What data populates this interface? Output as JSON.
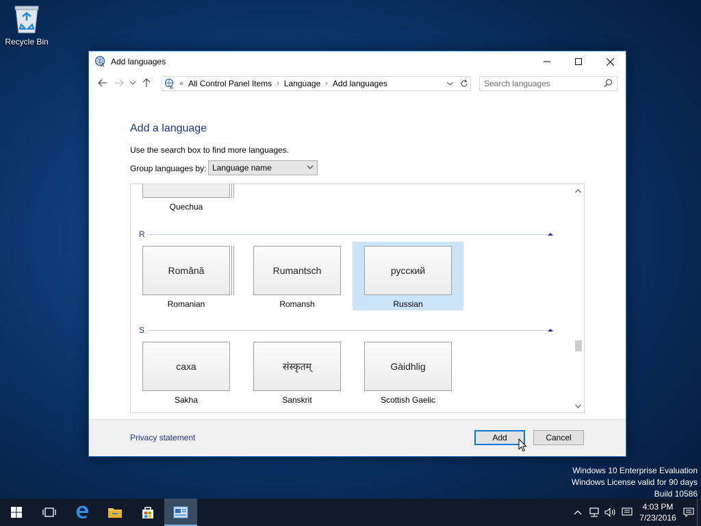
{
  "desktop": {
    "recycle_bin_label": "Recycle Bin"
  },
  "window": {
    "title": "Add languages",
    "address": {
      "overflow": "«",
      "crumbs": [
        "All Control Panel Items",
        "Language",
        "Add languages"
      ]
    },
    "search_placeholder": "Search languages",
    "heading": "Add a language",
    "hint": "Use the search box to find more languages.",
    "group_by_label": "Group languages by:",
    "group_by_value": "Language name",
    "sections": {
      "prev_tile": {
        "name": "Quechua"
      },
      "r": {
        "letter": "R",
        "tiles": [
          {
            "native": "Română",
            "name": "Romanian"
          },
          {
            "native": "Rumantsch",
            "name": "Romansh"
          },
          {
            "native": "русский",
            "name": "Russian",
            "selected": true
          }
        ]
      },
      "s": {
        "letter": "S",
        "tiles": [
          {
            "native": "саха",
            "name": "Sakha"
          },
          {
            "native": "संस्कृतम्",
            "name": "Sanskrit"
          },
          {
            "native": "Gàidhlig",
            "name": "Scottish Gaelic"
          }
        ]
      }
    },
    "footer": {
      "privacy_link": "Privacy statement",
      "add_label": "Add",
      "cancel_label": "Cancel"
    }
  },
  "watermark": {
    "line1": "Windows 10 Enterprise Evaluation",
    "line2": "Windows License valid for 90 days",
    "line3": "Build 10586"
  },
  "taskbar": {
    "clock_time": "4:03 PM",
    "clock_date": "7/23/2016"
  },
  "colors": {
    "accent": "#0078d7",
    "heading": "#1e3287",
    "selection": "#cce4f7"
  }
}
